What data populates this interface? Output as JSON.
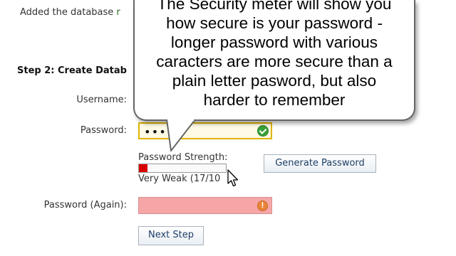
{
  "notice": {
    "prefix": "Added the database ",
    "truncated": "r"
  },
  "step": {
    "heading": "Step 2: Create Datab"
  },
  "form": {
    "username_label": "Username:",
    "password_label": "Password:",
    "password_value": "•••••",
    "password_again_label": "Password (Again):",
    "password_again_value": ""
  },
  "strength": {
    "label": "Password Strength:",
    "text": "Very Weak (17/10",
    "fill_fraction": 0.1,
    "fill_color": "#d90000"
  },
  "buttons": {
    "generate_password": "Generate Password",
    "next_step": "Next Step"
  },
  "callout": {
    "lines": [
      "The Security meter will show you",
      "how secure is your password -",
      "longer password with various",
      "caracters are more secure than a",
      "plain letter pasword, but also",
      "harder to remember"
    ]
  },
  "icons": {
    "password_status": "check-circle-icon",
    "password_again_status": "error-circle-icon",
    "cursor": "mouse-pointer-icon"
  },
  "colors": {
    "valid_field_border": "#e0b400",
    "invalid_field_bg": "#f6a6a6",
    "check_green": "#3aa23a",
    "error_orange": "#e8843a",
    "button_text": "#1d3f66"
  }
}
